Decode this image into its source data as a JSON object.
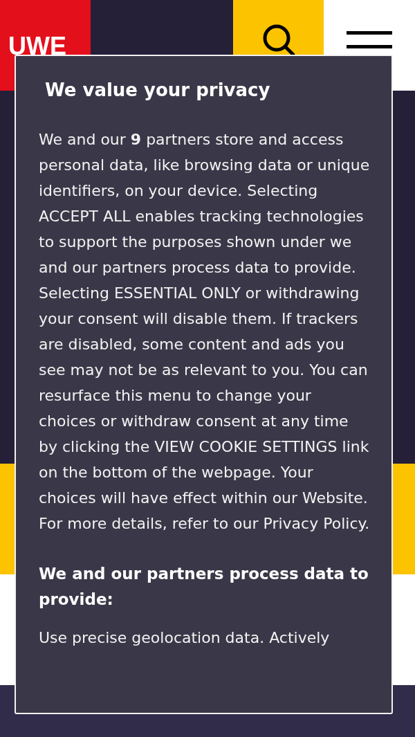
{
  "header": {
    "logo": "UWE"
  },
  "dialog": {
    "title": "We value your privacy",
    "intro": "We and our **9** partners store and access personal data, like browsing data or unique identifiers, on your device. Selecting ACCEPT ALL enables tracking technologies to support the purposes shown under we and our partners process data to provide. Selecting ESSENTIAL ONLY or withdrawing your consent will disable them. If trackers are disabled, some content and ads you see may not be as relevant to you. You can resurface this menu to change your choices or withdraw consent at any time by clicking the VIEW COOKIE SETTINGS link on the bottom of the webpage. Your choices will have effect within our Website. For more details, refer to our Privacy Policy.",
    "purposes_heading": "We and our partners process data to provide:",
    "purposes": "Use precise geolocation data. Actively"
  }
}
